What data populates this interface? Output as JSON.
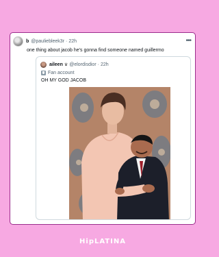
{
  "post": {
    "name": "b",
    "handle": "@pauliebleek3r",
    "separator": "·",
    "time": "22h",
    "text": "one thing about jacob he's gonna find someone named guillermo",
    "more_icon": "more-horizontal-icon"
  },
  "quote": {
    "name": "aileen",
    "badge": "♛",
    "handle": "@elordisdior",
    "separator": "·",
    "time": "22h",
    "fan_label": "Fan account",
    "text": "OH MY GOD JACOB"
  },
  "colors": {
    "background": "#f7a9e2",
    "card_border": "#9b2c8c",
    "text_primary": "#0f1419",
    "text_secondary": "#536471"
  },
  "logo": {
    "text": "HipLATINA"
  }
}
